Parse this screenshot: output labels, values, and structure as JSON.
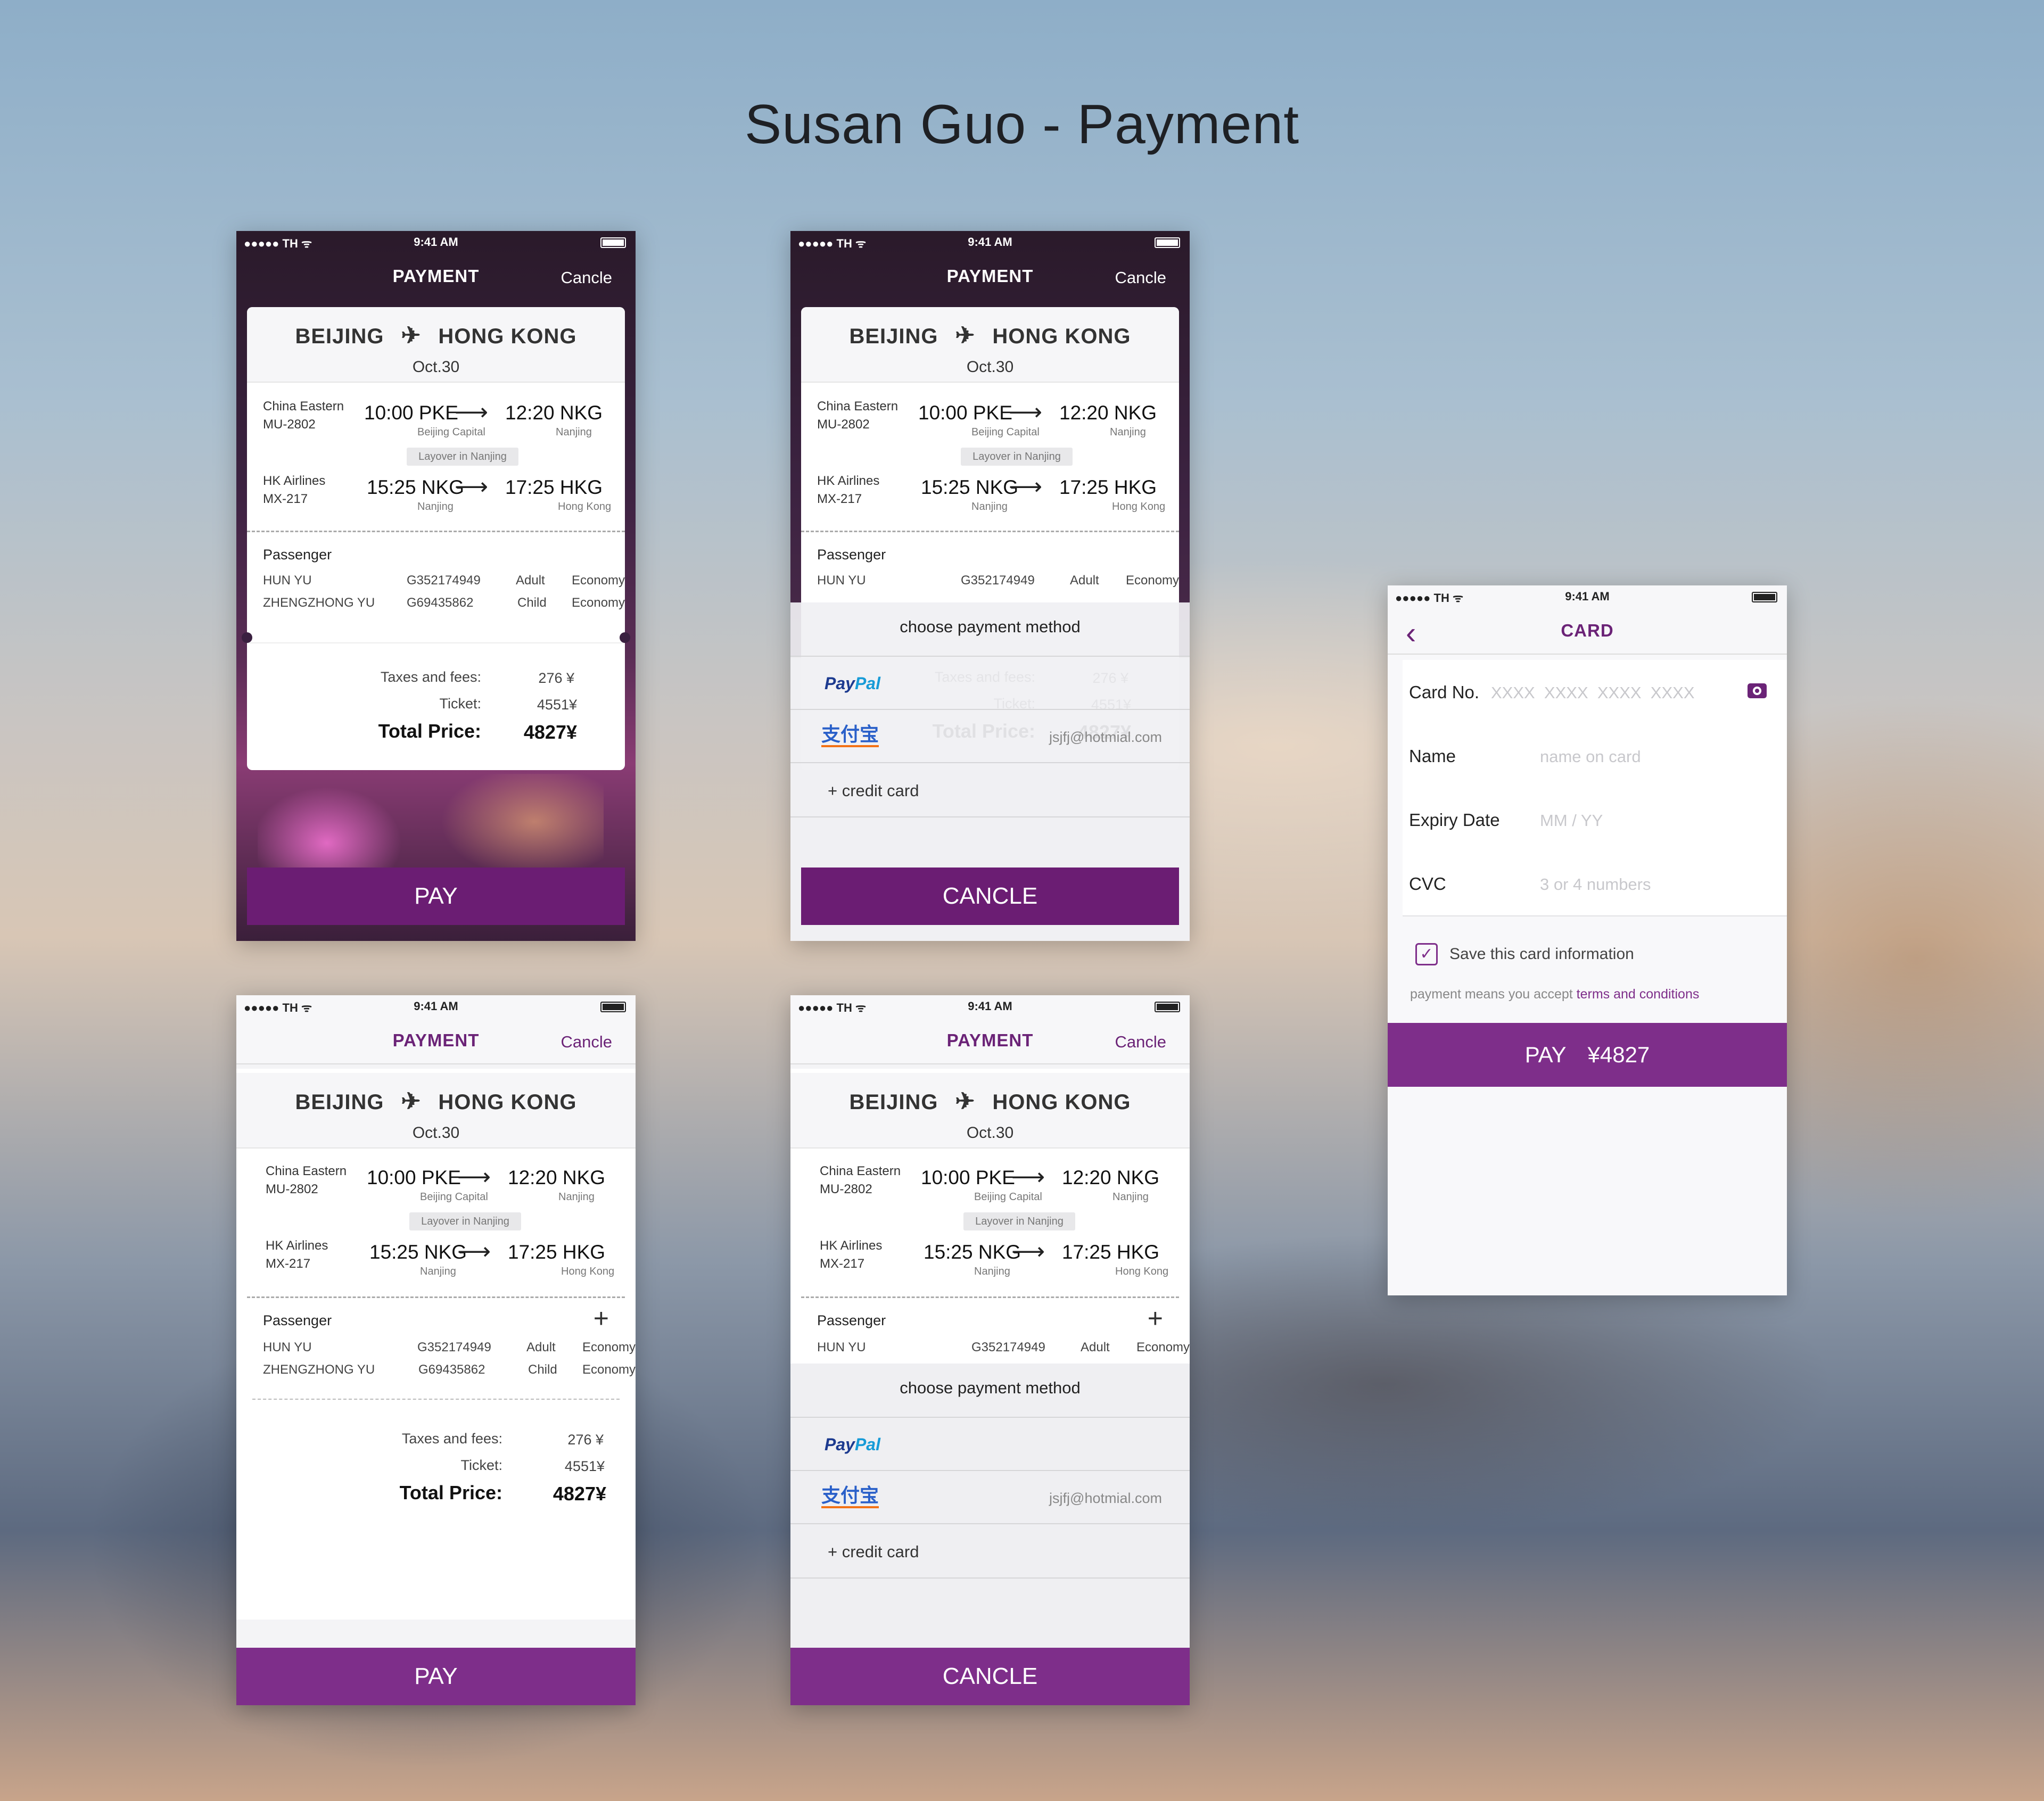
{
  "page_title": "Susan Guo - Payment",
  "status": {
    "carrier": "●●●●● TH ᯤ",
    "time": "9:41 AM"
  },
  "nav": {
    "title": "PAYMENT",
    "cancel": "Cancle"
  },
  "route": {
    "from": "BEIJING",
    "to": "HONG KONG",
    "date": "Oct.30"
  },
  "flights": [
    {
      "airline": "China Eastern",
      "number": "MU-2802",
      "dep": "10:00 PKE",
      "arr": "12:20 NKG",
      "dep_city": "Beijing Capital",
      "arr_city": "Nanjing"
    },
    {
      "airline": "HK Airlines",
      "number": "MX-217",
      "dep": "15:25 NKG",
      "arr": "17:25 HKG",
      "dep_city": "Nanjing",
      "arr_city": "Hong Kong"
    }
  ],
  "layover": "Layover in Nanjing",
  "passenger_title": "Passenger",
  "passengers": [
    {
      "name": "HUN YU",
      "id": "G352174949",
      "type": "Adult",
      "class": "Economy"
    },
    {
      "name": "ZHENGZHONG YU",
      "id": "G69435862",
      "type": "Child",
      "class": "Economy"
    }
  ],
  "prices": {
    "taxes_label": "Taxes and fees:",
    "taxes": "276 ¥",
    "ticket_label": "Ticket:",
    "ticket": "4551¥",
    "total_label": "Total Price:",
    "total": "4827¥"
  },
  "pay_label": "PAY",
  "cancel_label": "CANCLE",
  "sheet": {
    "title": "choose payment method",
    "paypal_a": "Pay",
    "paypal_b": "Pal",
    "alipay": "支付宝",
    "email": "jsjfj@hotmial.com",
    "credit": "+ credit card"
  },
  "card_screen": {
    "title": "CARD",
    "card_no_label": "Card No.",
    "card_no_placeholder": "XXXX  XXXX  XXXX  XXXX",
    "name_label": "Name",
    "name_placeholder": "name on card",
    "expiry_label": "Expiry Date",
    "expiry_placeholder": "MM / YY",
    "cvc_label": "CVC",
    "cvc_placeholder": "3 or 4 numbers",
    "save_label": "Save this card information",
    "terms_prefix": "payment means you accept ",
    "terms_link": "terms and conditions",
    "pay_label": "PAY",
    "pay_amount": "¥4827"
  },
  "colors": {
    "accent": "#7e2e8a",
    "accent_dark": "#6b1d73"
  }
}
